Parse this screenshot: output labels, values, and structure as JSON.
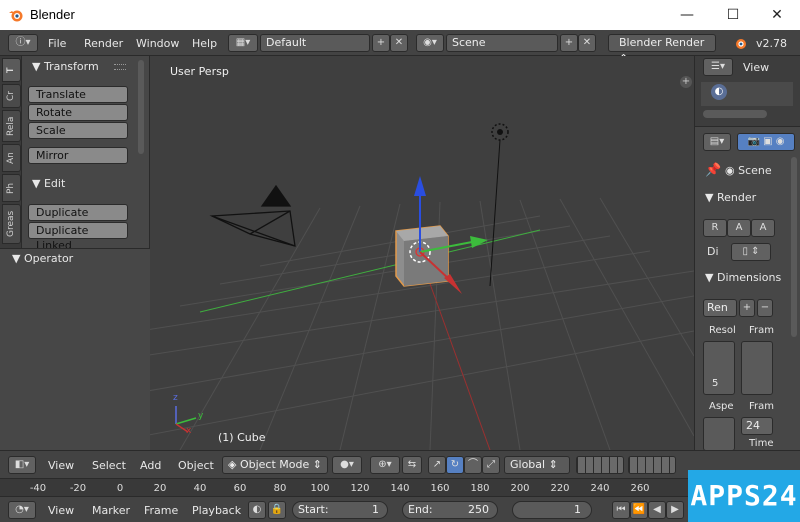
{
  "window": {
    "title": "Blender",
    "minimize": "—",
    "maximize": "☐",
    "close": "✕"
  },
  "info_header": {
    "menus": [
      "File",
      "Render",
      "Window",
      "Help"
    ],
    "layout": "Default",
    "scene": "Scene",
    "engine": "Blender Render",
    "version": "v2.78"
  },
  "tool_tabs": [
    "T",
    "Cr",
    "Rela",
    "An",
    "Ph",
    "Greas"
  ],
  "tool_panel": {
    "transform_header": "Transform",
    "transform_buttons": [
      "Translate",
      "Rotate",
      "Scale"
    ],
    "mirror": "Mirror",
    "edit_header": "Edit",
    "edit_buttons": [
      "Duplicate",
      "Duplicate Linked"
    ]
  },
  "operator_header": "Operator",
  "viewport": {
    "view_label": "User Persp",
    "object_label": "(1) Cube",
    "axis_x": "x",
    "axis_y": "y",
    "axis_z": "z"
  },
  "outliner": {
    "view_menu": "View"
  },
  "properties": {
    "scene_label": "Scene",
    "render_header": "Render",
    "render_buttons": [
      "R",
      "A",
      "A"
    ],
    "display_label": "Di",
    "dimensions_header": "Dimensions",
    "preset": "Ren",
    "resolution_label": "Resol",
    "frame_label": "Fram",
    "res_value": "5",
    "aspect_label": "Aspe",
    "frame_rate_label": "Fram",
    "frame_rate": "24",
    "time_label": "Time"
  },
  "viewport_header": {
    "menus": [
      "View",
      "Select",
      "Add",
      "Object"
    ],
    "mode": "Object Mode",
    "orientation": "Global"
  },
  "timeline": {
    "ticks": [
      "-40",
      "-20",
      "0",
      "20",
      "40",
      "60",
      "80",
      "100",
      "120",
      "140",
      "160",
      "180",
      "200",
      "220",
      "240",
      "260"
    ]
  },
  "timeline_header": {
    "menus": [
      "View",
      "Marker",
      "Frame",
      "Playback"
    ],
    "start_label": "Start:",
    "start_value": "1",
    "end_label": "End:",
    "end_value": "250",
    "current_frame": "1"
  },
  "watermark": "APPS24",
  "colors": {
    "accent": "#5680c2",
    "watermark": "#23a8e6",
    "x_axis": "#c83232",
    "y_axis": "#3cbc3c",
    "z_axis": "#2a4ee0"
  }
}
